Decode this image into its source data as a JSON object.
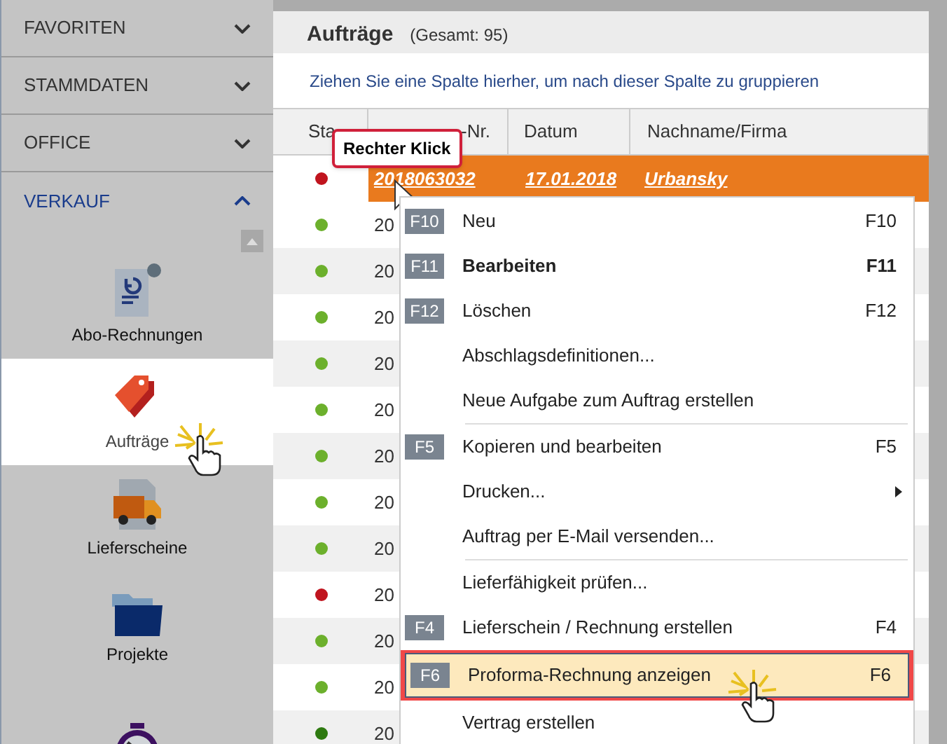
{
  "sidebar": {
    "sections": [
      {
        "label": "FAVORITEN",
        "expanded": false
      },
      {
        "label": "STAMMDATEN",
        "expanded": false
      },
      {
        "label": "OFFICE",
        "expanded": false
      },
      {
        "label": "VERKAUF",
        "expanded": true
      }
    ],
    "items": [
      {
        "label": "Abo-Rechnungen",
        "selected": false
      },
      {
        "label": "Aufträge",
        "selected": true
      },
      {
        "label": "Lieferscheine",
        "selected": false
      },
      {
        "label": "Projekte",
        "selected": false
      },
      {
        "selected": false
      }
    ]
  },
  "header": {
    "title": "Aufträge",
    "count": "(Gesamt: 95)"
  },
  "group_hint": "Ziehen Sie eine Spalte hierher, um nach dieser Spalte zu gruppieren",
  "table": {
    "columns": [
      "Sta",
      "-Nr.",
      "Datum",
      "Nachname/Firma"
    ],
    "rows": [
      {
        "color": "#c0141e",
        "number": "2018063032",
        "date": "17.01.2018",
        "name": "Urbansky",
        "selected": true
      },
      {
        "color": "#6cb02c",
        "number": "20",
        "selected": false
      },
      {
        "color": "#6cb02c",
        "number": "20",
        "selected": false
      },
      {
        "color": "#6cb02c",
        "number": "20",
        "selected": false
      },
      {
        "color": "#6cb02c",
        "number": "20",
        "selected": false
      },
      {
        "color": "#6cb02c",
        "number": "20",
        "selected": false
      },
      {
        "color": "#6cb02c",
        "number": "20",
        "selected": false
      },
      {
        "color": "#6cb02c",
        "number": "20",
        "selected": false
      },
      {
        "color": "#6cb02c",
        "number": "20",
        "selected": false
      },
      {
        "color": "#c0141e",
        "number": "20",
        "selected": false
      },
      {
        "color": "#6cb02c",
        "number": "20",
        "selected": false
      },
      {
        "color": "#6cb02c",
        "number": "20",
        "selected": false
      },
      {
        "color": "#2e7a10",
        "number": "20",
        "selected": false
      }
    ]
  },
  "tooltip": "Rechter Klick",
  "context_menu": [
    {
      "kind": "item",
      "key": "F10",
      "label": "Neu",
      "shortcut": "F10",
      "bold": false,
      "submenu": false,
      "selected": false
    },
    {
      "kind": "item",
      "key": "F11",
      "label": "Bearbeiten",
      "shortcut": "F11",
      "bold": true,
      "submenu": false,
      "selected": false
    },
    {
      "kind": "item",
      "key": "F12",
      "label": "Löschen",
      "shortcut": "F12",
      "bold": false,
      "submenu": false,
      "selected": false
    },
    {
      "kind": "item",
      "label": "Abschlagsdefinitionen...",
      "bold": false,
      "submenu": false,
      "selected": false
    },
    {
      "kind": "item",
      "label": "Neue Aufgabe zum Auftrag erstellen",
      "bold": false,
      "submenu": false,
      "selected": false
    },
    {
      "kind": "separator"
    },
    {
      "kind": "item",
      "key": "F5",
      "label": "Kopieren und bearbeiten",
      "shortcut": "F5",
      "bold": false,
      "submenu": false,
      "selected": false
    },
    {
      "kind": "item",
      "label": "Drucken...",
      "bold": false,
      "submenu": true,
      "selected": false
    },
    {
      "kind": "item",
      "label": "Auftrag per E-Mail versenden...",
      "bold": false,
      "submenu": false,
      "selected": false
    },
    {
      "kind": "separator"
    },
    {
      "kind": "item",
      "label": "Lieferfähigkeit prüfen...",
      "bold": false,
      "submenu": false,
      "selected": false
    },
    {
      "kind": "item",
      "key": "F4",
      "label": "Lieferschein / Rechnung erstellen",
      "shortcut": "F4",
      "bold": false,
      "submenu": false,
      "selected": false
    },
    {
      "kind": "item",
      "key": "F6",
      "label": "Proforma-Rechnung anzeigen",
      "shortcut": "F6",
      "bold": false,
      "submenu": false,
      "selected": true
    },
    {
      "kind": "item",
      "label": "Vertrag erstellen",
      "bold": false,
      "submenu": false,
      "selected": false
    }
  ]
}
